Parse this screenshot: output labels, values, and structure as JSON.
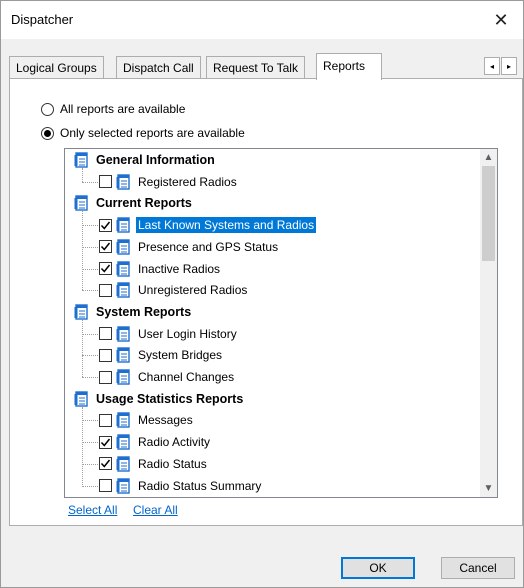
{
  "window": {
    "title": "Dispatcher",
    "close": "✕"
  },
  "tabs": [
    {
      "label": "Logical Groups",
      "active": false
    },
    {
      "label": "Dispatch Call",
      "active": false
    },
    {
      "label": "Request To Talk",
      "active": false
    },
    {
      "label": "Reports",
      "active": true
    }
  ],
  "tab_scroll": {
    "left": "◂",
    "right": "▸"
  },
  "options": {
    "all": {
      "label": "All reports are available",
      "checked": false
    },
    "selected": {
      "label": "Only selected reports are available",
      "checked": true
    }
  },
  "tree": {
    "groups": [
      {
        "label": "General Information",
        "items": [
          {
            "label": "Registered Radios",
            "checked": false
          }
        ]
      },
      {
        "label": "Current Reports",
        "items": [
          {
            "label": "Last Known Systems and Radios",
            "checked": true,
            "selected": true
          },
          {
            "label": "Presence and GPS Status",
            "checked": true
          },
          {
            "label": "Inactive Radios",
            "checked": true
          },
          {
            "label": "Unregistered Radios",
            "checked": false
          }
        ]
      },
      {
        "label": "System Reports",
        "items": [
          {
            "label": "User Login History",
            "checked": false
          },
          {
            "label": "System Bridges",
            "checked": false
          },
          {
            "label": "Channel Changes",
            "checked": false
          }
        ]
      },
      {
        "label": "Usage Statistics Reports",
        "items": [
          {
            "label": "Messages",
            "checked": false
          },
          {
            "label": "Radio Activity",
            "checked": true
          },
          {
            "label": "Radio Status",
            "checked": true
          },
          {
            "label": "Radio Status Summary",
            "checked": false
          }
        ]
      }
    ],
    "scroll_up": "▲",
    "scroll_down": "▼"
  },
  "links": {
    "select_all": "Select All",
    "clear_all": "Clear All"
  },
  "buttons": {
    "ok": "OK",
    "cancel": "Cancel"
  },
  "colors": {
    "selection": "#0078d7",
    "link": "#0066cc",
    "icon_blue": "#1e6fd0"
  }
}
